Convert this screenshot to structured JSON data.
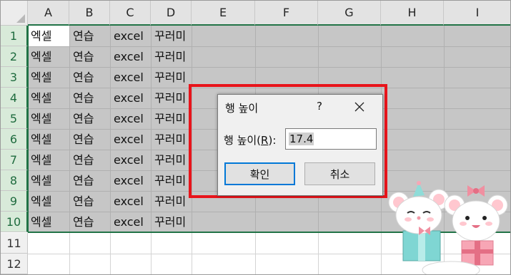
{
  "columns": [
    "A",
    "B",
    "C",
    "D",
    "E",
    "F",
    "G",
    "H",
    "I"
  ],
  "rows": [
    "1",
    "2",
    "3",
    "4",
    "5",
    "6",
    "7",
    "8",
    "9",
    "10",
    "11",
    "12"
  ],
  "cell_values": {
    "a": "엑셀",
    "b": "연습",
    "c": "excel",
    "d": "꾸러미"
  },
  "dialog": {
    "title": "행 높이",
    "help": "?",
    "label": "행 높이(",
    "label_key": "R",
    "label_end": "):",
    "value": "17.4",
    "ok_label": "확인",
    "cancel_label": "취소"
  },
  "colors": {
    "selection_fill": "#c6c6c6",
    "header_accent": "#217346",
    "highlight_box": "#e8141b",
    "ok_button_border": "#0078d7"
  }
}
